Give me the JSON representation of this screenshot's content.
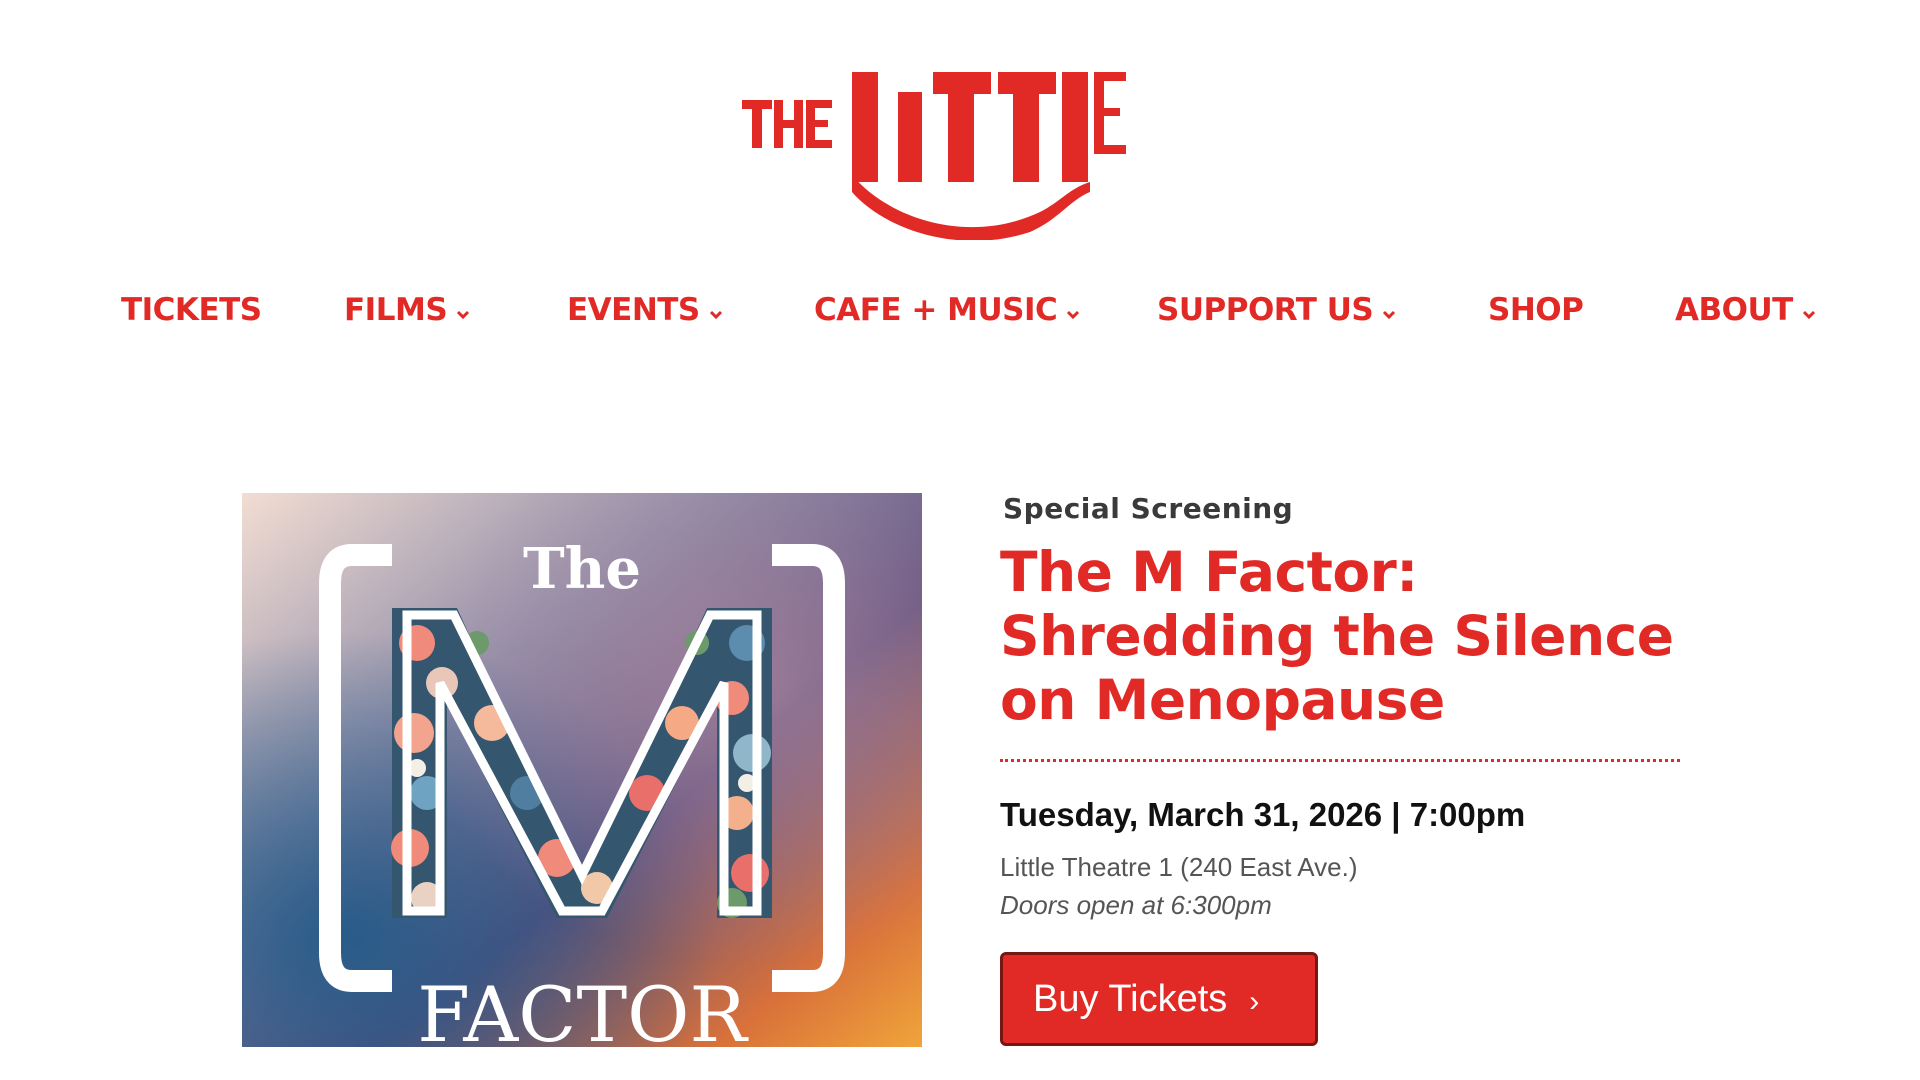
{
  "brand": {
    "logo_text": "THE LITTLE",
    "accent_color": "#e12a26"
  },
  "nav": {
    "items": [
      {
        "label": "TICKETS",
        "has_dropdown": false
      },
      {
        "label": "FILMS",
        "has_dropdown": true
      },
      {
        "label": "EVENTS",
        "has_dropdown": true
      },
      {
        "label": "CAFE + MUSIC",
        "has_dropdown": true
      },
      {
        "label": "SUPPORT US",
        "has_dropdown": true
      },
      {
        "label": "SHOP",
        "has_dropdown": false
      },
      {
        "label": "ABOUT",
        "has_dropdown": true
      }
    ],
    "dropdown_icon": "chevron-down-icon"
  },
  "event": {
    "poster": {
      "text_top": "The",
      "text_letter": "M",
      "text_bottom": "FACTOR"
    },
    "category": "Special Screening",
    "title": "The M Factor: Shredding the Silence on Menopause",
    "datetime": "Tuesday, March 31, 2026 | 7:00pm",
    "venue": "Little Theatre 1 (240 East Ave.)",
    "doors": "Doors open at 6:300pm",
    "buy_label": "Buy Tickets",
    "buy_icon": "chevron-right-icon"
  }
}
